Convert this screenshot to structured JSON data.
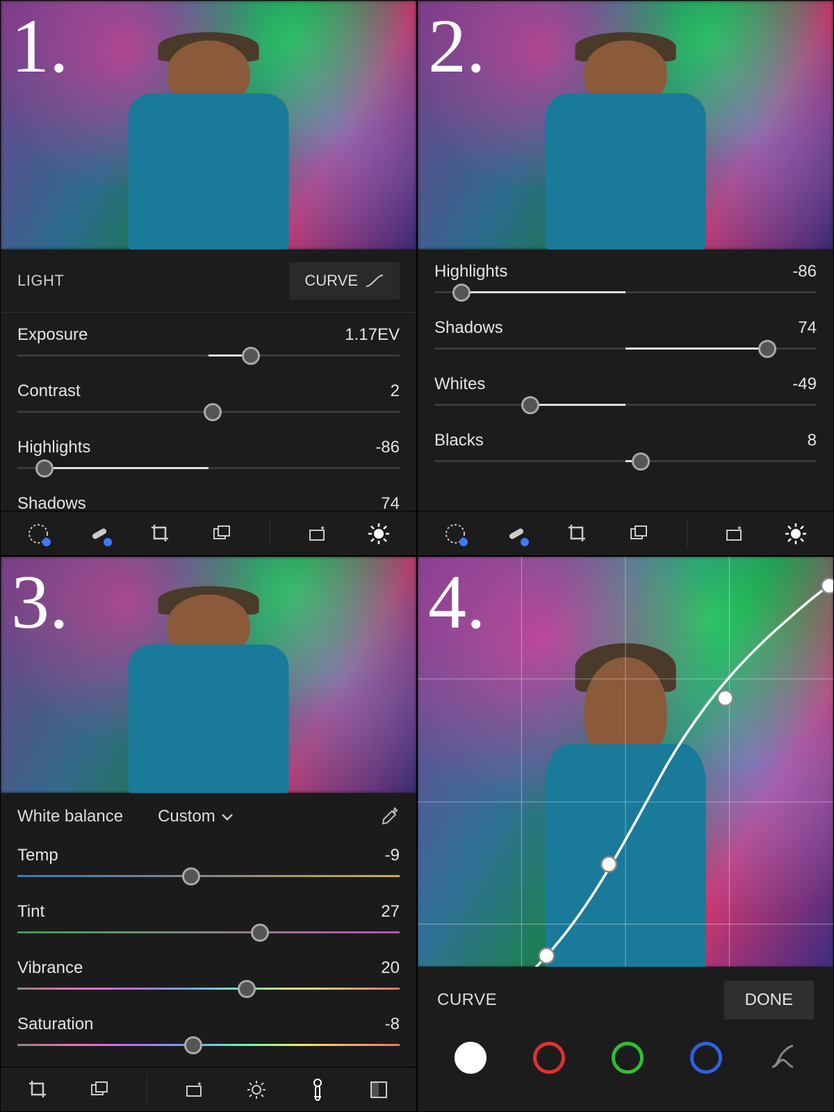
{
  "steps": [
    "1.",
    "2.",
    "3.",
    "4."
  ],
  "panel1": {
    "section_title": "LIGHT",
    "curve_label": "CURVE",
    "sliders": {
      "exposure": {
        "label": "Exposure",
        "value": "1.17EV",
        "pct": 59,
        "fill_from": 50,
        "fill_to": 59
      },
      "contrast": {
        "label": "Contrast",
        "value": "2",
        "pct": 51,
        "fill_from": 50,
        "fill_to": 51
      },
      "highlights": {
        "label": "Highlights",
        "value": "-86",
        "pct": 7,
        "fill_from": 7,
        "fill_to": 50
      },
      "shadows": {
        "label": "Shadows",
        "value": "74"
      }
    }
  },
  "panel2": {
    "sliders": {
      "highlights": {
        "label": "Highlights",
        "value": "-86",
        "pct": 7,
        "fill_from": 7,
        "fill_to": 50
      },
      "shadows": {
        "label": "Shadows",
        "value": "74",
        "pct": 87,
        "fill_from": 50,
        "fill_to": 87
      },
      "whites": {
        "label": "Whites",
        "value": "-49",
        "pct": 25,
        "fill_from": 25,
        "fill_to": 50
      },
      "blacks": {
        "label": "Blacks",
        "value": "8",
        "pct": 54,
        "fill_from": 50,
        "fill_to": 54
      }
    }
  },
  "panel3": {
    "wb_label": "White balance",
    "wb_value": "Custom",
    "sliders": {
      "temp": {
        "label": "Temp",
        "value": "-9",
        "pct": 45.5
      },
      "tint": {
        "label": "Tint",
        "value": "27",
        "pct": 63.5
      },
      "vibrance": {
        "label": "Vibrance",
        "value": "20",
        "pct": 60
      },
      "saturation": {
        "label": "Saturation",
        "value": "-8",
        "pct": 46
      }
    }
  },
  "panel4": {
    "curve_label": "CURVE",
    "done_label": "DONE"
  }
}
